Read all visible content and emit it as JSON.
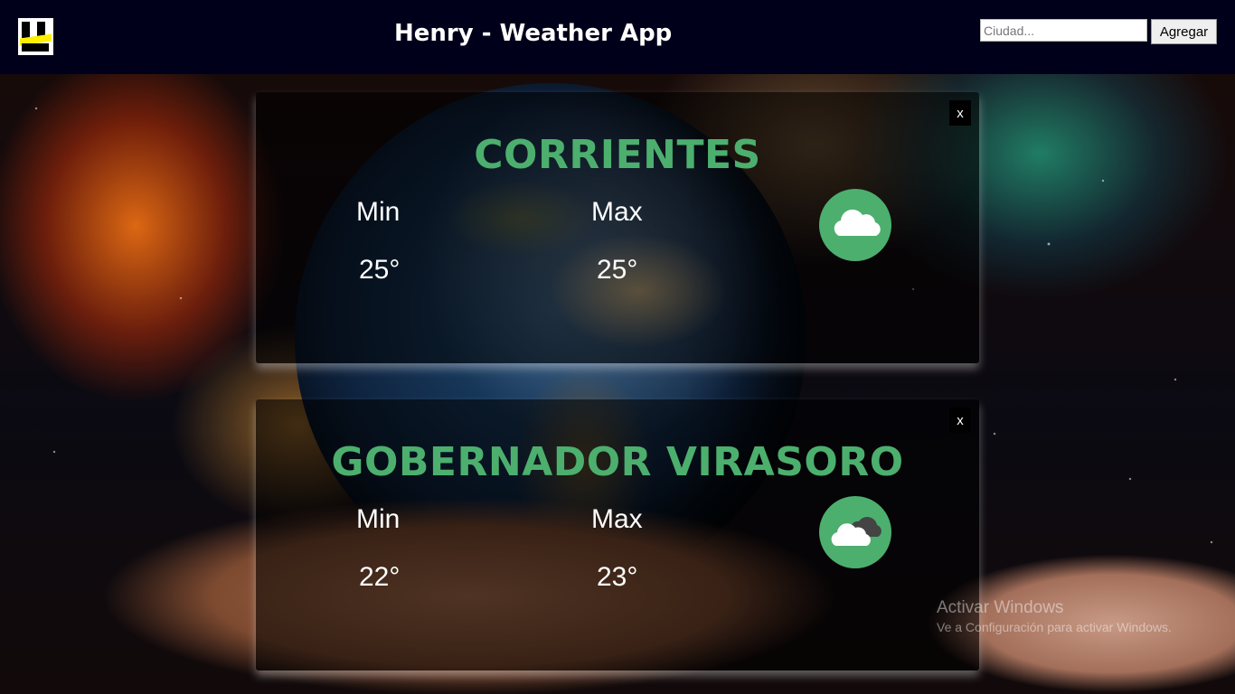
{
  "header": {
    "title": "Henry - Weather App",
    "search_placeholder": "Ciudad...",
    "search_value": "",
    "add_label": "Agregar"
  },
  "cards": [
    {
      "city": "CORRIENTES",
      "min_label": "Min",
      "max_label": "Max",
      "min_temp": "25°",
      "max_temp": "25°",
      "close_label": "x",
      "weather_icon": "cloud-icon"
    },
    {
      "city": "GOBERNADOR VIRASORO",
      "min_label": "Min",
      "max_label": "Max",
      "min_temp": "22°",
      "max_temp": "23°",
      "close_label": "x",
      "weather_icon": "broken-clouds-icon"
    }
  ],
  "watermark": {
    "line1": "Activar Windows",
    "line2": "Ve a Configuración para activar Windows."
  },
  "colors": {
    "accent_green": "#4caf6e",
    "header_bg": "#00001a"
  }
}
